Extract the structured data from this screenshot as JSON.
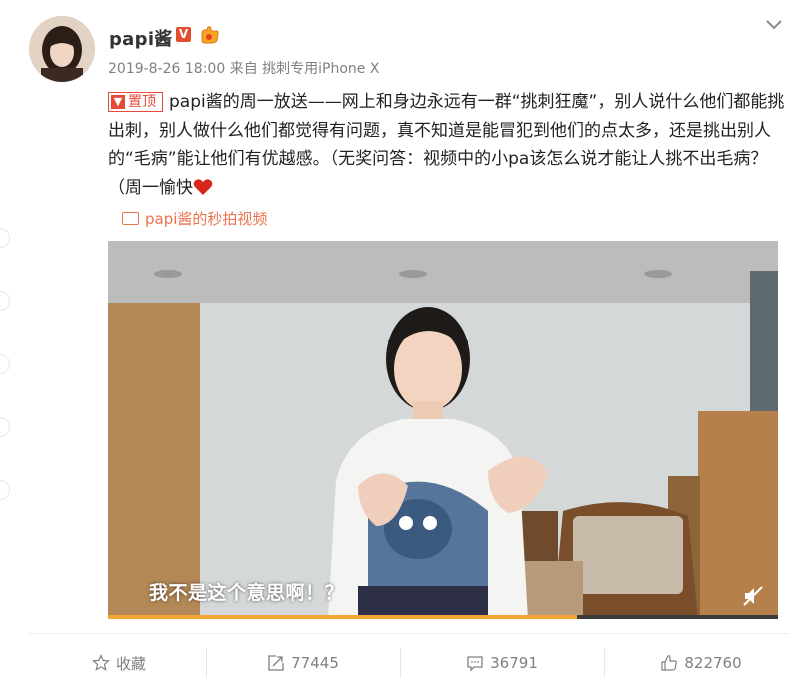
{
  "user": {
    "name": "papi酱",
    "verified_badge": "V",
    "medal_icon": "hand-medal-icon"
  },
  "post": {
    "meta": "2019-8-26 18:00 来自 挑刺专用iPhone X",
    "pin_label": "置顶",
    "text": "papi酱的周一放送——网上和身边永远有一群“挑刺狂魔”，别人说什么他们都能挑出刺，别人做什么他们都觉得有问题，真不知道是能冒犯到他们的点太多，还是挑出别人的“毛病”能让他们有优越感。（无奖问答：视频中的小pa该怎么说才能让人挑不出毛病？（周一愉快",
    "video_link": "papi酱的秒拍视频"
  },
  "video": {
    "subtitle": "我不是这个意思啊！？",
    "progress": 0.7
  },
  "actions": {
    "favorite": "收藏",
    "repost": "77445",
    "comment": "36791",
    "like": "822760"
  },
  "colors": {
    "accent": "#eb7350",
    "pin": "#e64a3b",
    "progress": "#f3a536"
  }
}
